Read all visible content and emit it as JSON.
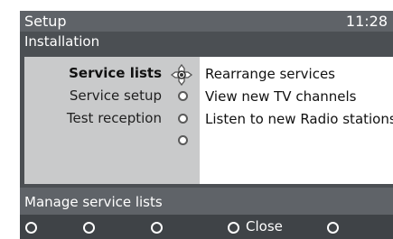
{
  "header": {
    "title": "Setup",
    "clock": "11:28"
  },
  "subheader": {
    "label": "Installation"
  },
  "menu": {
    "items": [
      {
        "label": "Service lists",
        "selected": true
      },
      {
        "label": "Service setup",
        "selected": false
      },
      {
        "label": "Test reception",
        "selected": false
      },
      {
        "label": "",
        "selected": false
      }
    ]
  },
  "submenu": {
    "items": [
      {
        "label": "Rearrange services"
      },
      {
        "label": "View new TV channels"
      },
      {
        "label": "Listen to new Radio stations"
      }
    ]
  },
  "status": {
    "text": "Manage service lists"
  },
  "buttons": [
    {
      "label": ""
    },
    {
      "label": ""
    },
    {
      "label": ""
    },
    {
      "label": "Close"
    },
    {
      "label": ""
    }
  ],
  "colors": {
    "title_bar": "#5f6368",
    "panel_dark": "#4b4f53",
    "panel_light": "#c9cacb",
    "button_bar": "#3f4347"
  }
}
